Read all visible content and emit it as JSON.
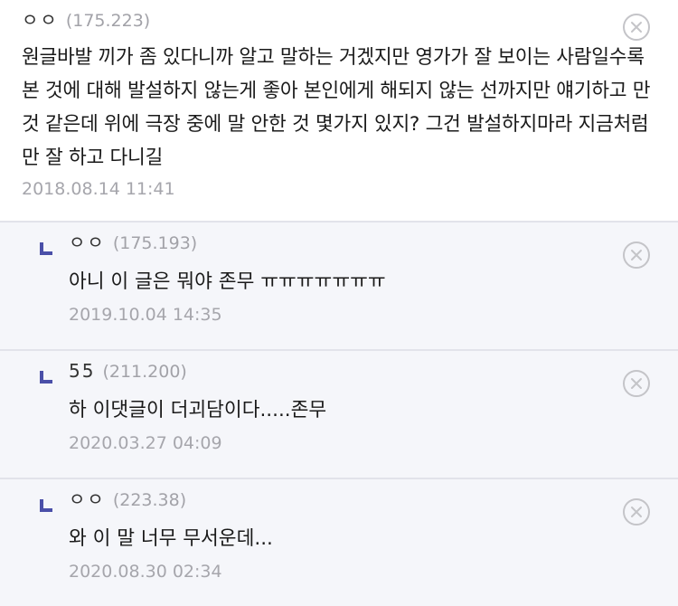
{
  "comments": [
    {
      "nickname": "ㅇㅇ",
      "ip": "(175.223)",
      "text": "원글바발 끼가 좀 있다니까 알고 말하는 거겠지만 영가가 잘 보이는 사람일수록 본 것에 대해 발설하지 않는게 좋아 본인에게 해되지 않는 선까지만 얘기하고 만 것 같은데 위에 극장 중에 말 안한 것 몇가지 있지? 그건 발설하지마라 지금처럼만 잘 하고 다니길",
      "date": "2018.08.14 11:41"
    }
  ],
  "replies": [
    {
      "nickname": "ㅇㅇ",
      "ip": "(175.193)",
      "text": "아니 이 글은 뭐야 존무 ㅠㅠㅠㅠㅠㅠㅠ",
      "date": "2019.10.04 14:35"
    },
    {
      "nickname": "55",
      "ip": "(211.200)",
      "text": "하 이댓글이 더괴담이다.....존무",
      "date": "2020.03.27 04:09"
    },
    {
      "nickname": "ㅇㅇ",
      "ip": "(223.38)",
      "text": "와 이 말 너무 무서운데...",
      "date": "2020.08.30 02:34"
    }
  ],
  "icons": {
    "delete": "close-circle-icon",
    "reply": "reply-arrow-icon"
  },
  "colors": {
    "reply_mark": "#4a4fa8",
    "reply_bg": "#f5f6fa",
    "muted": "#a6a6ac"
  }
}
